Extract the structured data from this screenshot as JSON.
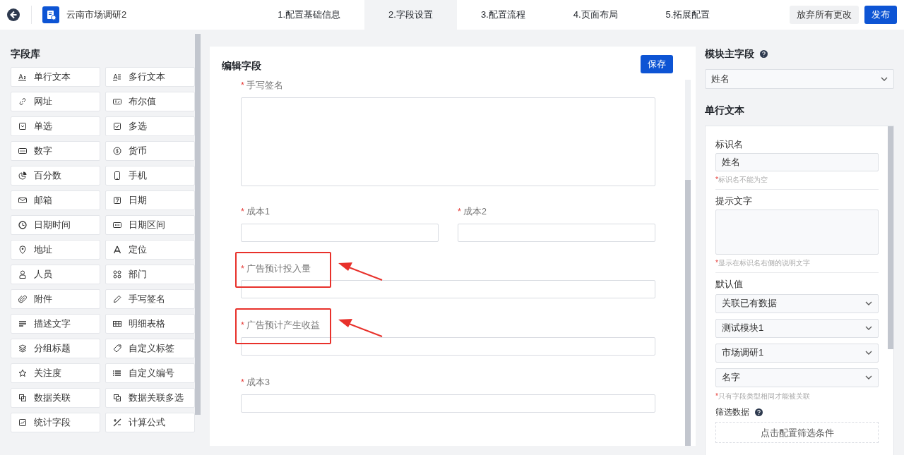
{
  "header": {
    "title": "云南市场调研2",
    "steps": [
      {
        "label": "1.配置基础信息",
        "selected": false
      },
      {
        "label": "2.字段设置",
        "selected": true
      },
      {
        "label": "3.配置流程",
        "selected": false
      },
      {
        "label": "4.页面布局",
        "selected": false
      },
      {
        "label": "5.拓展配置",
        "selected": false
      }
    ],
    "buttons": [
      {
        "label": "放弃所有更改",
        "kind": "secondary"
      },
      {
        "label": "发布",
        "kind": "primary"
      }
    ]
  },
  "field_library": {
    "title": "字段库",
    "items": [
      "单行文本",
      "多行文本",
      "网址",
      "布尔值",
      "单选",
      "多选",
      "数字",
      "货币",
      "百分数",
      "手机",
      "邮箱",
      "日期",
      "日期时间",
      "日期区间",
      "地址",
      "定位",
      "人员",
      "部门",
      "附件",
      "手写签名",
      "描述文字",
      "明细表格",
      "分组标题",
      "自定义标签",
      "关注度",
      "自定义编号",
      "数据关联",
      "数据关联多选",
      "统计字段",
      "计算公式"
    ]
  },
  "editor": {
    "title": "编辑字段",
    "save": "保存",
    "fields": [
      {
        "mark": "*",
        "label": "手写签名",
        "kind": "textarea",
        "annotated": false
      },
      {
        "mark": "*",
        "label": "成本1",
        "kind": "half",
        "annotated": false
      },
      {
        "mark": "*",
        "label": "成本2",
        "kind": "half",
        "annotated": false
      },
      {
        "mark": "*",
        "label": "广告预计投入量",
        "kind": "full",
        "annotated": true
      },
      {
        "mark": "*",
        "label": "广告预计产生收益",
        "kind": "full",
        "annotated": true
      },
      {
        "mark": "*",
        "label": "成本3",
        "kind": "full",
        "annotated": false
      }
    ]
  },
  "primary_field": {
    "title": "模块主字段",
    "value": "姓名"
  },
  "properties": {
    "title": "单行文本",
    "name_label": "标识名",
    "name_value": "姓名",
    "name_hint": {
      "mark": "*",
      "text": "标识名不能为空"
    },
    "tip_label": "提示文字",
    "tip_hint": {
      "mark": "*",
      "text": "显示在标识名右侧的说明文字"
    },
    "default_label": "默认值",
    "selects": [
      "关联已有数据",
      "测试模块1",
      "市场调研1",
      "名字"
    ],
    "select_hint": {
      "mark": "*",
      "text": "只有字段类型相同才能被关联"
    },
    "filter_label": "筛选数据",
    "filter_button": "点击配置筛选条件"
  }
}
